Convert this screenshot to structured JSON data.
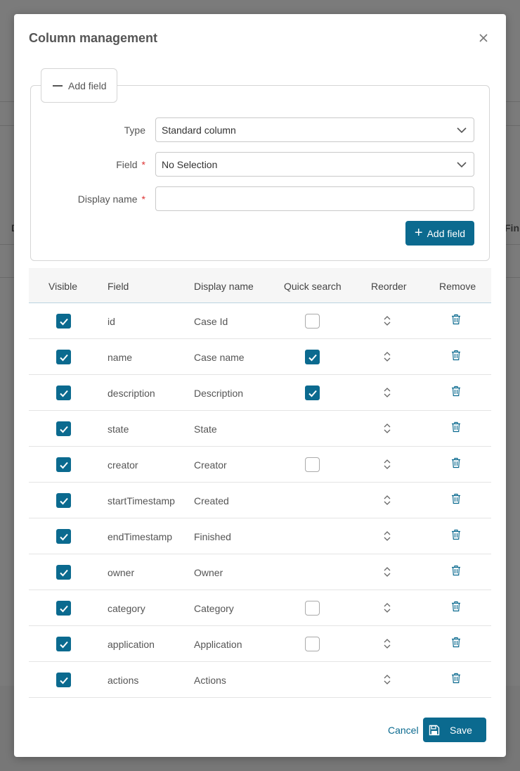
{
  "background": {
    "left_text": "D",
    "right_text": "Fini"
  },
  "modal": {
    "title": "Column management"
  },
  "add_section": {
    "toggle_label": "Add field",
    "type_label": "Type",
    "type_value": "Standard column",
    "field_label": "Field",
    "field_value": "No Selection",
    "display_name_label": "Display name",
    "display_name_value": "",
    "required_mark": "*",
    "add_button_label": "Add field"
  },
  "table": {
    "headers": {
      "visible": "Visible",
      "field": "Field",
      "display_name": "Display name",
      "quick_search": "Quick search",
      "reorder": "Reorder",
      "remove": "Remove"
    },
    "rows": [
      {
        "visible": true,
        "field": "id",
        "display_name": "Case Id",
        "quick_search": false
      },
      {
        "visible": true,
        "field": "name",
        "display_name": "Case name",
        "quick_search": true
      },
      {
        "visible": true,
        "field": "description",
        "display_name": "Description",
        "quick_search": true
      },
      {
        "visible": true,
        "field": "state",
        "display_name": "State",
        "quick_search": null
      },
      {
        "visible": true,
        "field": "creator",
        "display_name": "Creator",
        "quick_search": false
      },
      {
        "visible": true,
        "field": "startTimestamp",
        "display_name": "Created",
        "quick_search": null
      },
      {
        "visible": true,
        "field": "endTimestamp",
        "display_name": "Finished",
        "quick_search": null
      },
      {
        "visible": true,
        "field": "owner",
        "display_name": "Owner",
        "quick_search": null
      },
      {
        "visible": true,
        "field": "category",
        "display_name": "Category",
        "quick_search": false
      },
      {
        "visible": true,
        "field": "application",
        "display_name": "Application",
        "quick_search": false
      },
      {
        "visible": true,
        "field": "actions",
        "display_name": "Actions",
        "quick_search": null
      }
    ]
  },
  "footer": {
    "cancel_label": "Cancel",
    "save_label": "Save"
  },
  "colors": {
    "accent": "#0b6a8f",
    "required": "#dd3333"
  }
}
